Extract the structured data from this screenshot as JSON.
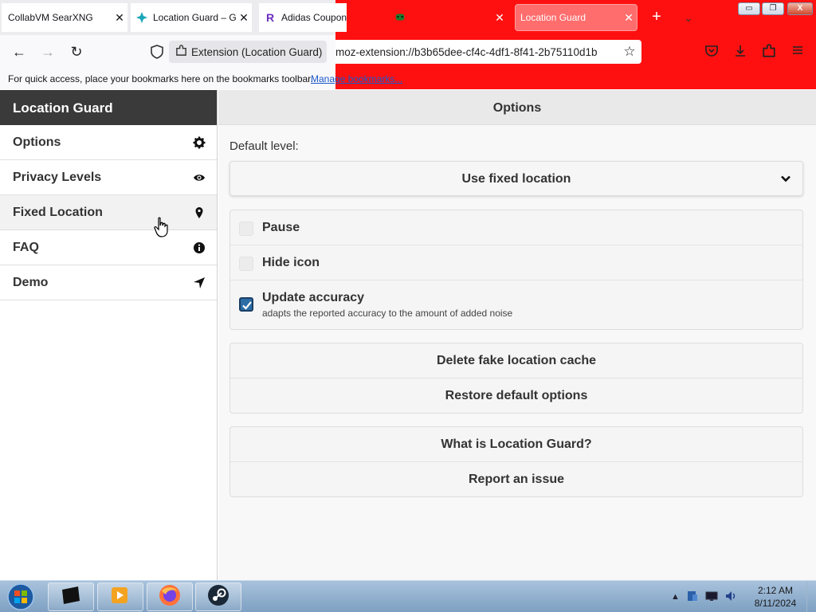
{
  "tabs": [
    {
      "label": "CollabVM SearXNG",
      "icon": "searxng-icon"
    },
    {
      "label": "Location Guard – G",
      "icon": "location-guard-favicon"
    },
    {
      "label": "Adidas Coupons",
      "icon": "r-logo-icon"
    },
    {
      "label": "",
      "icon": "alien-icon"
    },
    {
      "label": "Location Guard",
      "icon": "location-guard-favicon",
      "active": true
    }
  ],
  "window_controls": {
    "minimize": "▭",
    "maximize": "❐",
    "close": "X"
  },
  "nav": {
    "ext_chip": "Extension (Location Guard)",
    "url": "moz-extension://b3b65dee-cf4c-4df1-8f41-2b75110d1b"
  },
  "bookmarks": {
    "text": "For quick access, place your bookmarks here on the bookmarks toolbar.",
    "link": "Manage bookmarks..."
  },
  "sidebar": {
    "title": "Location Guard",
    "items": [
      {
        "label": "Options",
        "icon": "gear-icon"
      },
      {
        "label": "Privacy Levels",
        "icon": "eye-icon"
      },
      {
        "label": "Fixed Location",
        "icon": "map-pin-icon"
      },
      {
        "label": "FAQ",
        "icon": "info-icon"
      },
      {
        "label": "Demo",
        "icon": "navigation-arrow-icon"
      }
    ]
  },
  "main": {
    "title": "Options",
    "default_level_label": "Default level:",
    "default_level_value": "Use fixed location",
    "checkboxes": [
      {
        "label": "Pause",
        "checked": false
      },
      {
        "label": "Hide icon",
        "checked": false
      },
      {
        "label": "Update accuracy",
        "checked": true,
        "description": "adapts the reported accuracy to the amount of added noise"
      }
    ],
    "cache_buttons": [
      "Delete fake location cache",
      "Restore default options"
    ],
    "help_buttons": [
      "What is Location Guard?",
      "Report an issue"
    ]
  },
  "taskbar": {
    "time": "2:12 AM",
    "date": "8/11/2024"
  },
  "colors": {
    "tabbar_theme_red": "#ff1010",
    "sidebar_header": "#3a3a3a",
    "checkbox_checked": "#2d6ea6",
    "link": "#1a57c8"
  }
}
